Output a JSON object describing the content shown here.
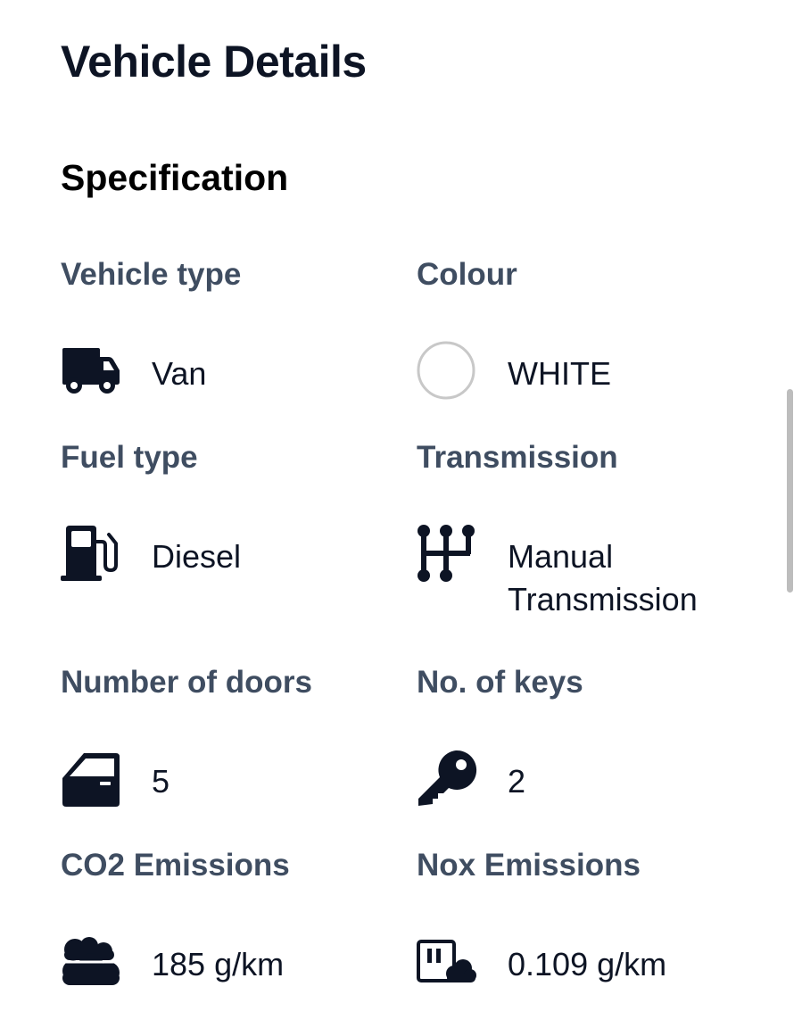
{
  "page": {
    "title": "Vehicle Details",
    "section_title": "Specification"
  },
  "specs": [
    {
      "label": "Vehicle type",
      "value": "Van",
      "icon": "van-icon"
    },
    {
      "label": "Colour",
      "value": "WHITE",
      "icon": "colour-swatch-icon",
      "swatch_color": "#ffffff"
    },
    {
      "label": "Fuel type",
      "value": "Diesel",
      "icon": "fuel-pump-icon"
    },
    {
      "label": "Transmission",
      "value": "Manual Transmission",
      "icon": "gear-shift-icon"
    },
    {
      "label": "Number of doors",
      "value": "5",
      "icon": "car-door-icon"
    },
    {
      "label": "No. of keys",
      "value": "2",
      "icon": "key-icon"
    },
    {
      "label": "CO2 Emissions",
      "value": "185 g/km",
      "icon": "clouds-icon"
    },
    {
      "label": "Nox Emissions",
      "value": "0.109 g/km",
      "icon": "smog-icon"
    }
  ],
  "colors": {
    "title": "#0d1424",
    "label": "#3f4d61",
    "value": "#0d1424",
    "icon": "#0d1424"
  }
}
